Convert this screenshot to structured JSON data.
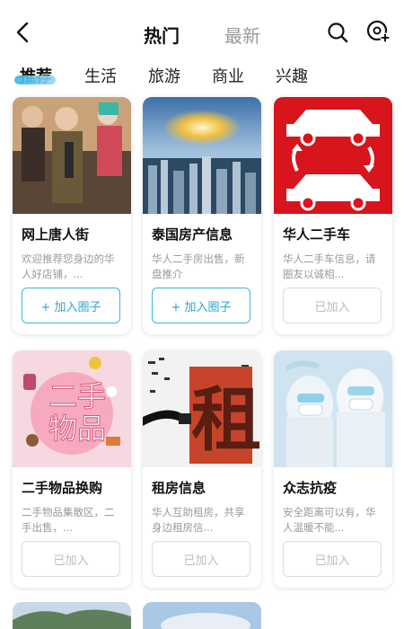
{
  "header": {
    "tab_hot": "热门",
    "tab_new": "最新"
  },
  "categories": [
    "推荐",
    "生活",
    "旅游",
    "商业",
    "兴趣"
  ],
  "colors": {
    "accent": "#2aa6d4",
    "muted": "#bdbdbd"
  },
  "cards": [
    {
      "title": "网上唐人街",
      "desc": "欢迎推荐您身边的华人好店铺，...",
      "button": "+ 加入圈子",
      "joined": false
    },
    {
      "title": "泰国房产信息",
      "desc": "华人二手房出售，新盘推介",
      "button": "+ 加入圈子",
      "joined": false
    },
    {
      "title": "华人二手车",
      "desc": "华人二手车信息，请圈友以诚相...",
      "button": "已加入",
      "joined": true
    },
    {
      "title": "二手物品换购",
      "desc": "二手物品集散区，二手出售，...",
      "button": "已加入",
      "joined": true
    },
    {
      "title": "租房信息",
      "desc": "华人互助租房，共享身边租房信...",
      "button": "已加入",
      "joined": true
    },
    {
      "title": "众志抗疫",
      "desc": "安全距离可以有，华人温暖不能...",
      "button": "已加入",
      "joined": true
    }
  ],
  "thumb_text": {
    "secondhand": [
      "二",
      "手",
      "物",
      "品"
    ],
    "rent": "租"
  }
}
